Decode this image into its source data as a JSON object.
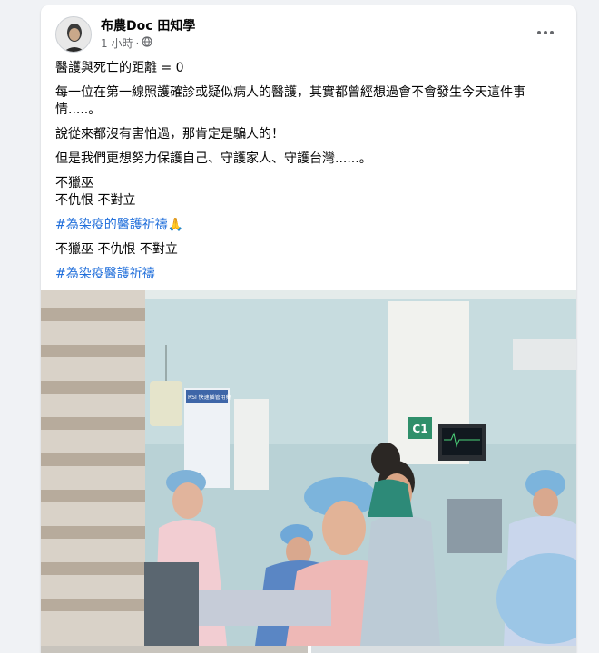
{
  "post": {
    "author": "布農Doc 田知學",
    "timestamp": "1 小時",
    "separator": "·",
    "audience_icon": "globe-icon",
    "more_icon": "more-options-icon",
    "lines": [
      "醫護與死亡的距離 = 0",
      "每一位在第一線照護確診或疑似病人的醫護，其實都曾經想過會不會發生今天這件事情.....。",
      "說從來都沒有害怕過，那肯定是騙人的！",
      "但是我們更想努力保護自己、守護家人、守護台灣......。",
      "不獵巫",
      "不仇恨 不對立"
    ],
    "hashtag1": "#為染疫的醫護祈禱",
    "hashtag1_emoji": "🙏",
    "line_after": "不獵巫 不仇恨 不對立",
    "hashtag2": "#為染疫醫護祈禱"
  },
  "photo": {
    "sign_text": "C1",
    "poster_title": "RSI 快速插管用藥"
  },
  "colors": {
    "page_bg": "#f0f2f5",
    "card_bg": "#ffffff",
    "hashtag": "#216fdb",
    "meta": "#65676b"
  }
}
